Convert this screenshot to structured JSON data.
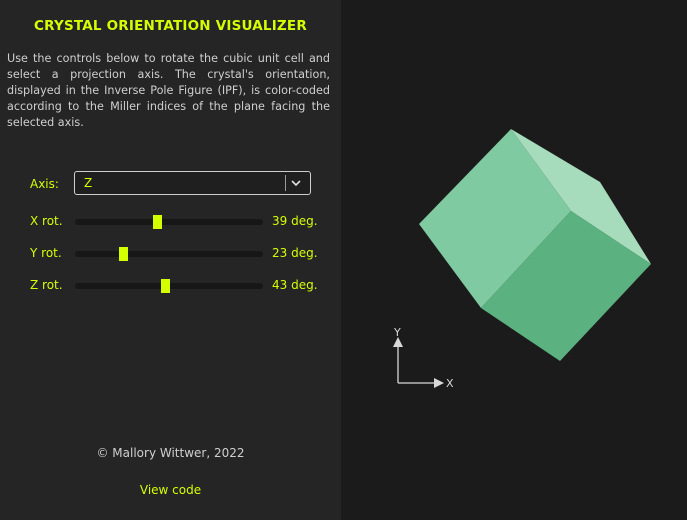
{
  "panel": {
    "title": "CRYSTAL ORIENTATION VISUALIZER",
    "description": "Use the controls below to rotate the cubic unit cell and select a projection axis. The crystal's orientation, displayed in the Inverse Pole Figure (IPF), is color-coded according to the Miller indices of the plane facing the selected axis.",
    "axis_label": "Axis:",
    "axis_value": "Z",
    "sliders": [
      {
        "label": "X rot.",
        "value_text": "39 deg.",
        "fraction": 0.44
      },
      {
        "label": "Y rot.",
        "value_text": "23 deg.",
        "fraction": 0.26
      },
      {
        "label": "Z rot.",
        "value_text": "43 deg.",
        "fraction": 0.48
      }
    ],
    "copyright": "© Mallory Wittwer, 2022",
    "view_code": "View code"
  },
  "viewport": {
    "axis_y_label": "Y",
    "axis_x_label": "X",
    "cube_colors": {
      "top": "#7fcaa0",
      "right": "#a6dcbc",
      "front": "#5bb280"
    }
  },
  "colors": {
    "accent": "#d4ff00",
    "panel_bg": "#252525",
    "viewport_bg": "#1b1b1b"
  }
}
